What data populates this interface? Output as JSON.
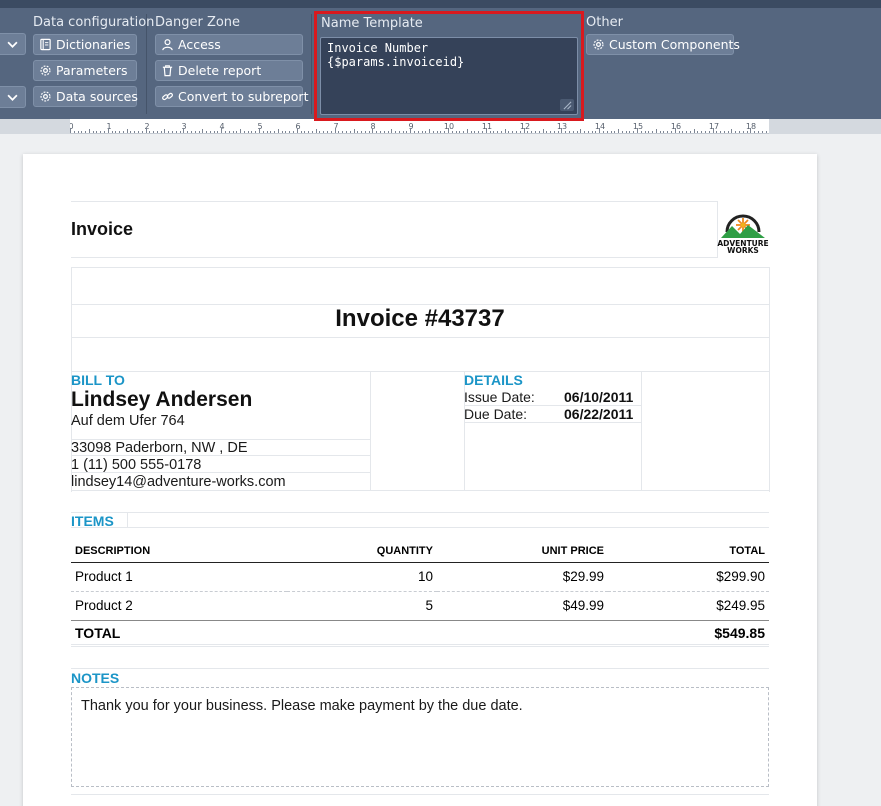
{
  "ribbon": {
    "groups": {
      "data_configuration": "Data configuration",
      "danger_zone": "Danger Zone",
      "name_template": "Name Template",
      "other": "Other"
    },
    "buttons": {
      "dictionaries": "Dictionaries",
      "parameters": "Parameters",
      "data_sources": "Data sources",
      "access": "Access",
      "delete_report": "Delete report",
      "convert_to_subreport": "Convert to subreport",
      "custom_components": "Custom Components"
    },
    "name_template_value": "Invoice Number {$params.invoiceid}"
  },
  "ruler": {
    "numbers": [
      "0",
      "1",
      "2",
      "3",
      "4",
      "5",
      "6",
      "7",
      "8",
      "9",
      "10",
      "11",
      "12",
      "13",
      "14",
      "15",
      "16",
      "17",
      "18"
    ]
  },
  "report": {
    "header_title": "Invoice",
    "logo": {
      "line1": "ADVENTURE",
      "line2": "WORKS",
      "icon": "adventure-works-logo"
    },
    "invoice_number": "Invoice #43737",
    "bill_to": {
      "label": "BILL TO",
      "name": "Lindsey Andersen",
      "street": "Auf dem Ufer 764",
      "city": "33098 Paderborn, NW , DE",
      "phone": "1 (11) 500 555-0178",
      "email": "lindsey14@adventure-works.com"
    },
    "details": {
      "label": "DETAILS",
      "issue_label": "Issue Date:",
      "issue_value": "06/10/2011",
      "due_label": "Due Date:",
      "due_value": "06/22/2011"
    },
    "items": {
      "label": "ITEMS",
      "headers": {
        "description": "DESCRIPTION",
        "quantity": "QUANTITY",
        "unit_price": "UNIT PRICE",
        "total": "TOTAL"
      },
      "rows": [
        {
          "description": "Product 1",
          "quantity": "10",
          "unit_price": "$29.99",
          "total": "$299.90"
        },
        {
          "description": "Product 2",
          "quantity": "5",
          "unit_price": "$49.99",
          "total": "$249.95"
        }
      ],
      "total_label": "TOTAL",
      "total_value": "$549.85"
    },
    "notes": {
      "label": "NOTES",
      "text": "Thank you for your business. Please make payment by the due date."
    }
  },
  "colors": {
    "ribbon": "#55667f",
    "accent": "#1b95c7",
    "highlight": "#d9191e"
  }
}
